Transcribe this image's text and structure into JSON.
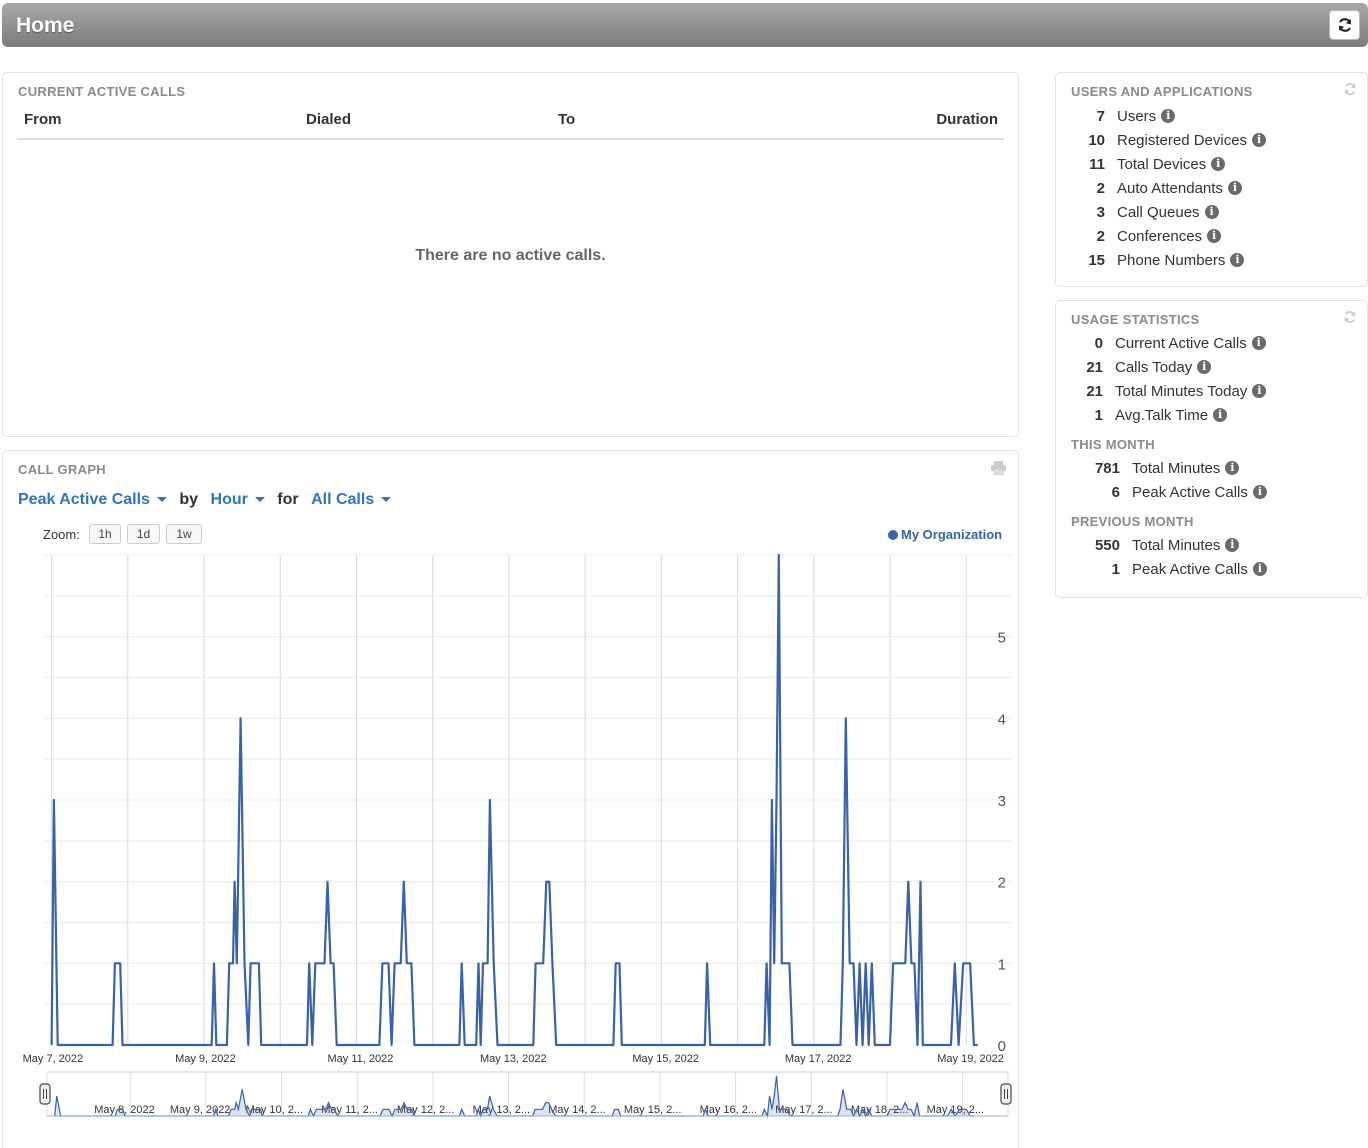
{
  "header": {
    "title": "Home"
  },
  "active_calls": {
    "title": "CURRENT ACTIVE CALLS",
    "columns": [
      "From",
      "Dialed",
      "To",
      "Duration"
    ],
    "empty_message": "There are no active calls."
  },
  "users_apps": {
    "title": "USERS AND APPLICATIONS",
    "items": [
      {
        "value": "7",
        "label": "Users"
      },
      {
        "value": "10",
        "label": "Registered Devices"
      },
      {
        "value": "11",
        "label": "Total Devices"
      },
      {
        "value": "2",
        "label": "Auto Attendants"
      },
      {
        "value": "3",
        "label": "Call Queues"
      },
      {
        "value": "2",
        "label": "Conferences"
      },
      {
        "value": "15",
        "label": "Phone Numbers"
      }
    ]
  },
  "usage": {
    "title": "USAGE STATISTICS",
    "today": [
      {
        "value": "0",
        "label": "Current Active Calls"
      },
      {
        "value": "21",
        "label": "Calls Today"
      },
      {
        "value": "21",
        "label": "Total Minutes Today"
      },
      {
        "value": "1",
        "label": "Avg.Talk Time"
      }
    ],
    "this_month_title": "THIS MONTH",
    "this_month": [
      {
        "value": "781",
        "label": "Total Minutes"
      },
      {
        "value": "6",
        "label": "Peak Active Calls"
      }
    ],
    "prev_month_title": "PREVIOUS MONTH",
    "prev_month": [
      {
        "value": "550",
        "label": "Total Minutes"
      },
      {
        "value": "1",
        "label": "Peak Active Calls"
      }
    ]
  },
  "call_graph": {
    "title": "CALL GRAPH",
    "metric": "Peak Active Calls",
    "by_word": "by",
    "interval": "Hour",
    "for_word": "for",
    "filter": "All Calls",
    "zoom_label": "Zoom:",
    "zoom_options": [
      "1h",
      "1d",
      "1w"
    ],
    "legend": "My Organization",
    "series_color": "#3a62a7"
  },
  "chart_data": {
    "type": "line",
    "series_name": "My Organization",
    "x_tick_labels": [
      "May 7, 2022",
      "May 9, 2022",
      "May 11, 2022",
      "May 13, 2022",
      "May 15, 2022",
      "May 17, 2022",
      "May 19, 2022"
    ],
    "y_tick_labels": [
      "0",
      "1",
      "2",
      "3",
      "4",
      "5"
    ],
    "ylim": [
      0,
      6
    ],
    "xlim_days": [
      6.9,
      19.6
    ],
    "navigator_labels": [
      "May 8, 2022",
      "May 9, 2022",
      "May 10, 2...",
      "May 11, 2...",
      "May 12, 2...",
      "May 13, 2...",
      "May 14, 2...",
      "May 15, 2...",
      "May 16, 2...",
      "May 17, 2...",
      "May 18, 2...",
      "May 19, 2..."
    ],
    "points": [
      [
        7.0,
        0
      ],
      [
        7.03,
        3
      ],
      [
        7.08,
        0
      ],
      [
        7.8,
        0
      ],
      [
        7.83,
        1
      ],
      [
        7.9,
        1
      ],
      [
        7.93,
        0
      ],
      [
        9.1,
        0
      ],
      [
        9.13,
        1
      ],
      [
        9.16,
        0
      ],
      [
        9.3,
        0
      ],
      [
        9.33,
        1
      ],
      [
        9.38,
        1
      ],
      [
        9.4,
        2
      ],
      [
        9.43,
        1
      ],
      [
        9.48,
        4
      ],
      [
        9.53,
        1
      ],
      [
        9.58,
        0
      ],
      [
        9.61,
        1
      ],
      [
        9.72,
        1
      ],
      [
        9.75,
        0
      ],
      [
        10.35,
        0
      ],
      [
        10.38,
        1
      ],
      [
        10.42,
        0
      ],
      [
        10.46,
        1
      ],
      [
        10.58,
        1
      ],
      [
        10.62,
        2
      ],
      [
        10.66,
        1
      ],
      [
        10.7,
        1
      ],
      [
        10.74,
        0
      ],
      [
        11.3,
        0
      ],
      [
        11.34,
        1
      ],
      [
        11.42,
        1
      ],
      [
        11.46,
        0
      ],
      [
        11.5,
        1
      ],
      [
        11.58,
        1
      ],
      [
        11.62,
        2
      ],
      [
        11.66,
        1
      ],
      [
        11.72,
        1
      ],
      [
        11.76,
        0
      ],
      [
        12.35,
        0
      ],
      [
        12.38,
        1
      ],
      [
        12.42,
        0
      ],
      [
        12.57,
        0
      ],
      [
        12.6,
        1
      ],
      [
        12.63,
        0
      ],
      [
        12.66,
        1
      ],
      [
        12.72,
        1
      ],
      [
        12.75,
        3
      ],
      [
        12.8,
        1
      ],
      [
        12.85,
        0
      ],
      [
        13.32,
        0
      ],
      [
        13.35,
        1
      ],
      [
        13.45,
        1
      ],
      [
        13.49,
        2
      ],
      [
        13.53,
        2
      ],
      [
        13.57,
        1
      ],
      [
        13.62,
        0
      ],
      [
        14.37,
        0
      ],
      [
        14.4,
        1
      ],
      [
        14.45,
        1
      ],
      [
        14.48,
        0
      ],
      [
        15.57,
        0
      ],
      [
        15.6,
        1
      ],
      [
        15.64,
        0
      ],
      [
        16.35,
        0
      ],
      [
        16.38,
        1
      ],
      [
        16.42,
        0
      ],
      [
        16.45,
        3
      ],
      [
        16.48,
        1
      ],
      [
        16.51,
        3
      ],
      [
        16.54,
        6
      ],
      [
        16.58,
        1
      ],
      [
        16.68,
        1
      ],
      [
        16.72,
        0
      ],
      [
        17.35,
        0
      ],
      [
        17.38,
        1
      ],
      [
        17.42,
        4
      ],
      [
        17.47,
        1
      ],
      [
        17.52,
        1
      ],
      [
        17.56,
        0
      ],
      [
        17.6,
        1
      ],
      [
        17.64,
        0
      ],
      [
        17.68,
        1
      ],
      [
        17.72,
        0
      ],
      [
        17.76,
        1
      ],
      [
        17.8,
        0
      ],
      [
        18.0,
        0
      ],
      [
        18.04,
        1
      ],
      [
        18.2,
        1
      ],
      [
        18.24,
        2
      ],
      [
        18.28,
        1
      ],
      [
        18.32,
        1
      ],
      [
        18.36,
        0
      ],
      [
        18.4,
        2
      ],
      [
        18.43,
        0
      ],
      [
        18.8,
        0
      ],
      [
        18.85,
        1
      ],
      [
        18.9,
        0
      ],
      [
        18.96,
        1
      ],
      [
        19.05,
        1
      ],
      [
        19.1,
        0
      ],
      [
        19.15,
        0
      ]
    ]
  }
}
